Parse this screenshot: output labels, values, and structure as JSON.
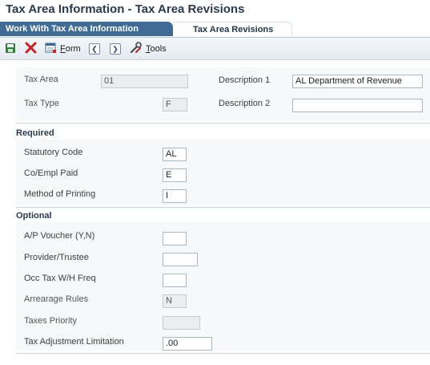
{
  "window": {
    "title": "Tax Area Information - Tax Area Revisions"
  },
  "tabs": [
    {
      "label": "Work With Tax Area Information"
    },
    {
      "label": "Tax Area Revisions"
    }
  ],
  "toolbar": {
    "save_icon": "save-icon",
    "cancel_icon": "close-icon",
    "form_label": "Form",
    "prev_icon": "chevron-left-icon",
    "next_icon": "chevron-right-icon",
    "tools_label": "Tools"
  },
  "header": {
    "tax_area_label": "Tax Area",
    "tax_area_value": "01",
    "tax_type_label": "Tax Type",
    "tax_type_value": "F",
    "description1_label": "Description 1",
    "description1_value": "AL Department of Revenue",
    "description2_label": "Description 2",
    "description2_value": ""
  },
  "required": {
    "title": "Required",
    "statutory_code_label": "Statutory Code",
    "statutory_code_value": "AL",
    "co_empl_paid_label": "Co/Empl Paid",
    "co_empl_paid_value": "E",
    "method_printing_label": "Method of Printing",
    "method_printing_value": "I"
  },
  "optional": {
    "title": "Optional",
    "ap_voucher_label": "A/P Voucher (Y,N)",
    "ap_voucher_value": "",
    "provider_label": "Provider/Trustee",
    "provider_value": "",
    "occ_tax_label": "Occ Tax W/H Freq",
    "occ_tax_value": "",
    "arrearage_label": "Arrearage Rules",
    "arrearage_value": "N",
    "taxes_priority_label": "Taxes Priority",
    "taxes_priority_value": "",
    "tax_adjustment_label": "Tax Adjustment Limitation",
    "tax_adjustment_value": ".00"
  },
  "colors": {
    "active_tab": "#3f6b95",
    "title_text": "#2a3a4e",
    "cancel_red": "#cc2020",
    "save_green": "#2f7d3a"
  }
}
